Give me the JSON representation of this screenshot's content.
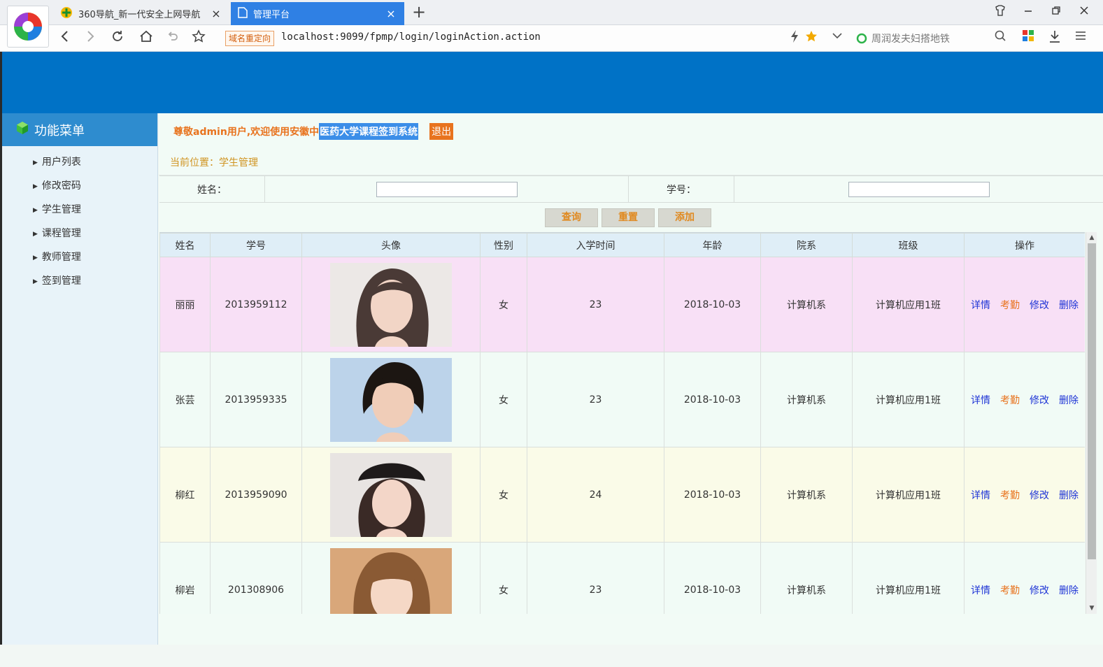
{
  "browser": {
    "tabs": [
      {
        "title": "360导航_新一代安全上网导航",
        "close": "×"
      },
      {
        "title": "管理平台",
        "close": "×"
      }
    ],
    "new_tab": "+",
    "redirect_badge": "域名重定向",
    "url": "localhost:9099/fpmp/login/loginAction.action",
    "search_placeholder": "周润发夫妇搭地铁"
  },
  "sidebar": {
    "title": "功能菜单",
    "items": [
      {
        "label": "用户列表"
      },
      {
        "label": "修改密码"
      },
      {
        "label": "学生管理"
      },
      {
        "label": "课程管理"
      },
      {
        "label": "教师管理"
      },
      {
        "label": "签到管理"
      }
    ]
  },
  "header": {
    "welcome_prefix": "尊敬admin用户,欢迎使用安徽中",
    "welcome_selected": "医药大学课程签到系统",
    "logout": "退出"
  },
  "breadcrumb": "当前位置：学生管理",
  "search": {
    "name_label": "姓名：",
    "name_value": "",
    "id_label": "学号：",
    "id_value": ""
  },
  "buttons": {
    "query": "查询",
    "reset": "重置",
    "add": "添加"
  },
  "table": {
    "headers": [
      "姓名",
      "学号",
      "头像",
      "性别",
      "入学时间",
      "年龄",
      "院系",
      "班级",
      "操作"
    ],
    "rows": [
      {
        "name": "丽丽",
        "id": "2013959112",
        "gender": "女",
        "enroll": "23",
        "age": "2018-10-03",
        "dept": "计算机系",
        "class": "计算机应用1班"
      },
      {
        "name": "张芸",
        "id": "2013959335",
        "gender": "女",
        "enroll": "23",
        "age": "2018-10-03",
        "dept": "计算机系",
        "class": "计算机应用1班"
      },
      {
        "name": "柳红",
        "id": "2013959090",
        "gender": "女",
        "enroll": "24",
        "age": "2018-10-03",
        "dept": "计算机系",
        "class": "计算机应用1班"
      },
      {
        "name": "柳岩",
        "id": "201308906",
        "gender": "女",
        "enroll": "23",
        "age": "2018-10-03",
        "dept": "计算机系",
        "class": "计算机应用1班"
      }
    ],
    "ops": {
      "detail": "详情",
      "attendance": "考勤",
      "edit": "修改",
      "delete": "删除"
    }
  },
  "colors": {
    "banner": "#0072c6",
    "accent": "#e8731e",
    "link": "#1f35d6",
    "active_tab": "#2f80e4"
  }
}
